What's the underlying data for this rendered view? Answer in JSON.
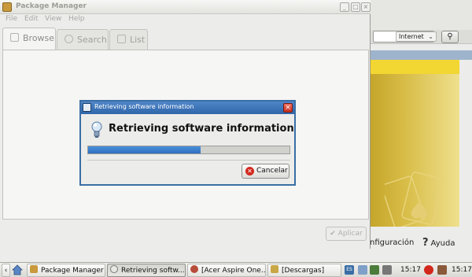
{
  "background_browser": {
    "search_engine": "Internet",
    "config_label": "nfiguración",
    "help_label": "Ayuda"
  },
  "package_manager": {
    "title": "Package Manager",
    "menu": [
      "File",
      "Edit",
      "View",
      "Help"
    ],
    "tabs": [
      {
        "label": "Browse",
        "active": true
      },
      {
        "label": "Search",
        "active": false
      },
      {
        "label": "List",
        "active": false
      }
    ],
    "apply_label": "Aplicar"
  },
  "dialog": {
    "title": "Retrieving software information",
    "heading": "Retrieving software information",
    "progress": 0.56,
    "cancel_label": "Cancelar"
  },
  "taskbar": {
    "items": [
      {
        "label": "Package Manager"
      },
      {
        "label": "Retrieving softw..."
      },
      {
        "label": "[Acer Aspire One..."
      },
      {
        "label": "[Descargas]"
      }
    ],
    "keyboard": "ES",
    "clock1": "15:17",
    "clock2": "15:17"
  },
  "colors": {
    "dialog_title": "#2f65a9",
    "progress_fill": "#2e6fbf",
    "cancel_icon": "#d2281c",
    "bg_yellow": "#f2d632"
  }
}
